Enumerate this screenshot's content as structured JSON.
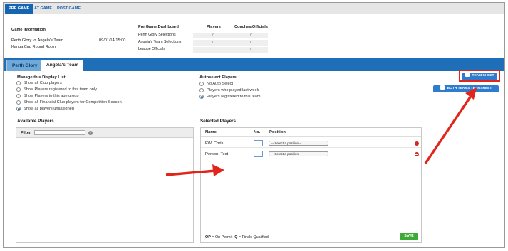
{
  "top_tabs": [
    "PRE GAME",
    "AT GAME",
    "POST GAME"
  ],
  "game_info": {
    "heading": "Game Information",
    "match": "Perth Glory vs Angela's Team",
    "date": "09/01/14 15:00",
    "round": "Kanga Cup Round Robin"
  },
  "dashboard": {
    "heading": "Pre Game Dashboard",
    "col_players": "Players",
    "col_coaches": "Coaches/Officials",
    "rows": [
      {
        "label": "Perth Glory Selections",
        "players": "0",
        "coaches": "0"
      },
      {
        "label": "Angela's Team Selections",
        "players": "0",
        "coaches": "0"
      },
      {
        "label": "League Officials",
        "players": "",
        "coaches": "0"
      }
    ]
  },
  "team_tabs": [
    "Perth Glory",
    "Angela's Team"
  ],
  "display_list": {
    "heading": "Manage this Display List",
    "options": [
      "Show all Club players",
      "Show Players registered to this team only",
      "Show Players to this age group",
      "Show all Financial Club players for Competition Season",
      "Show all players unassigned"
    ],
    "selected": 4
  },
  "autoselect": {
    "heading": "Autoselect Players",
    "options": [
      "No Auto Select",
      "Players who played last week",
      "Players registered to this team"
    ],
    "selected": 2
  },
  "buttons": {
    "team_sheet": "TEAM SHEET",
    "both_teams": "BOTH TEAMS TEAMSHEET",
    "save": "SAVE"
  },
  "available": {
    "heading": "Available Players",
    "filter_label": "Filter"
  },
  "selected_players": {
    "heading": "Selected Players",
    "columns": [
      "Name",
      "No.",
      "Position"
    ],
    "rows": [
      {
        "name": "FW, Chris",
        "position": "-- Select a position --"
      },
      {
        "name": "Person, Test",
        "position": "-- Select a position --"
      }
    ],
    "legend_op_key": "OP",
    "legend_op": " = On Permit",
    "legend_q_key": "Q",
    "legend_q": " = Finals Qualified"
  },
  "colors": {
    "accent": "#1e6fb8",
    "annotation": "#e0261b",
    "save": "#3daa33"
  }
}
